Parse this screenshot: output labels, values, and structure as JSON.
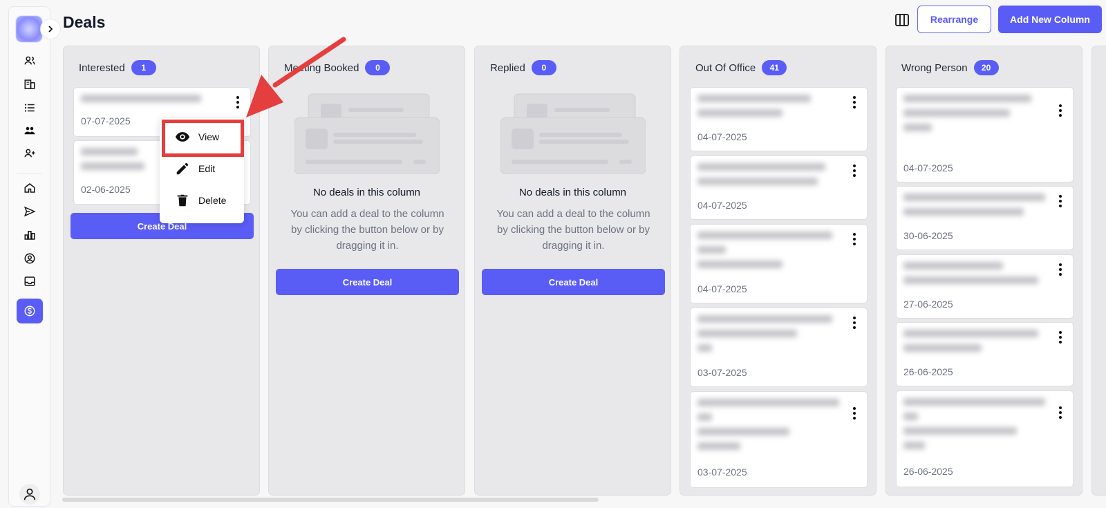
{
  "page": {
    "title": "Deals"
  },
  "toolbar": {
    "rearrange_label": "Rearrange",
    "add_column_label": "Add New Column",
    "columns_icon": "columns-icon"
  },
  "sidebar": {
    "items": [
      {
        "icon": "contacts-icon"
      },
      {
        "icon": "companies-icon"
      },
      {
        "icon": "lists-icon"
      },
      {
        "icon": "team-icon"
      },
      {
        "icon": "add-user-icon"
      },
      {
        "icon": "home-icon"
      },
      {
        "icon": "send-icon"
      },
      {
        "icon": "analytics-icon"
      },
      {
        "icon": "account-icon"
      },
      {
        "icon": "inbox-icon"
      },
      {
        "icon": "deals-icon",
        "active": true
      }
    ],
    "accent": "#5a5cf6"
  },
  "columns": [
    {
      "title": "Interested",
      "count": "1",
      "cards": [
        {
          "date": "07-07-2025"
        },
        {
          "date": "02-06-2025"
        }
      ],
      "create_label": "Create Deal"
    },
    {
      "title": "Meeting Booked",
      "count": "0",
      "empty_title": "No deals in this column",
      "empty_desc": "You can add a deal to the column by clicking the button below or by dragging it in.",
      "create_label": "Create Deal"
    },
    {
      "title": "Replied",
      "count": "0",
      "empty_title": "No deals in this column",
      "empty_desc": "You can add a deal to the column by clicking the button below or by dragging it in.",
      "create_label": "Create Deal"
    },
    {
      "title": "Out Of Office",
      "count": "41",
      "cards": [
        {
          "date": "04-07-2025"
        },
        {
          "date": "04-07-2025"
        },
        {
          "date": "04-07-2025"
        },
        {
          "date": "03-07-2025"
        },
        {
          "date": "03-07-2025"
        }
      ]
    },
    {
      "title": "Wrong Person",
      "count": "20",
      "cards": [
        {
          "date": "04-07-2025"
        },
        {
          "date": "30-06-2025"
        },
        {
          "date": "27-06-2025"
        },
        {
          "date": "26-06-2025"
        },
        {
          "date": "26-06-2025"
        }
      ]
    }
  ],
  "card_menu": {
    "items": [
      {
        "label": "View",
        "icon": "eye-icon"
      },
      {
        "label": "Edit",
        "icon": "pencil-icon"
      },
      {
        "label": "Delete",
        "icon": "trash-icon"
      }
    ]
  },
  "annotation": {
    "color": "#e53e3e"
  }
}
